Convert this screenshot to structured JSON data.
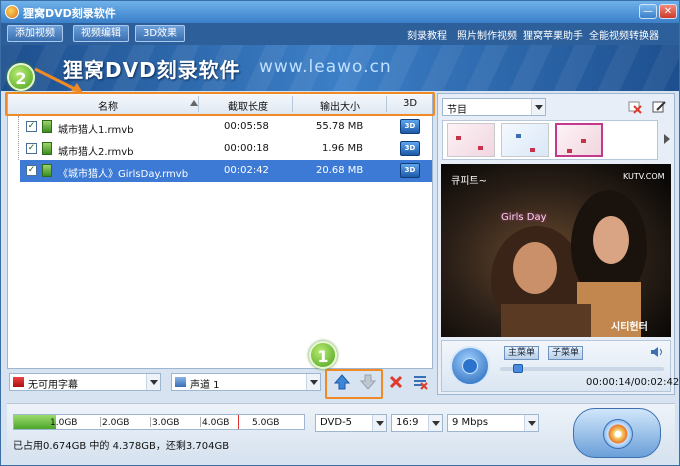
{
  "window": {
    "title": "狸窝DVD刻录软件",
    "min": "—",
    "close": "✕"
  },
  "menubar": {
    "buttons": [
      "添加视频",
      "视频编辑",
      "3D效果"
    ],
    "links": [
      "刻录教程",
      "照片制作视频",
      "狸窝苹果助手",
      "全能视频转换器"
    ]
  },
  "banner": {
    "title": "狸窝DVD刻录软件",
    "url": "www.leawo.cn"
  },
  "table": {
    "columns": [
      "名称",
      "截取长度",
      "输出大小",
      "3D"
    ],
    "rows": [
      {
        "name": "城市猎人1.rmvb",
        "length": "00:05:58",
        "size": "55.78 MB",
        "threeD": "3D",
        "checked": "✓"
      },
      {
        "name": "城市猎人2.rmvb",
        "length": "00:00:18",
        "size": "1.96 MB",
        "threeD": "3D",
        "checked": "✓"
      },
      {
        "name": "《城市猎人》GirlsDay.rmvb",
        "length": "00:02:42",
        "size": "20.68 MB",
        "threeD": "3D",
        "checked": "✓"
      }
    ]
  },
  "subtitle_select": "无可用字幕",
  "audio_select": "声道 1",
  "callouts": {
    "one": "1",
    "two": "2"
  },
  "right": {
    "program_select": "节目",
    "menu_buttons": [
      "主菜单",
      "子菜单"
    ],
    "video_texts": {
      "top_left": "큐피트~",
      "top_right": "KUTV.COM",
      "song": "Girls Day",
      "bottom_right": "시티헌터"
    },
    "time": "00:00:14/00:02:42",
    "playback_fraction": 0.086
  },
  "bottom": {
    "capacity_ticks": [
      "1.0GB",
      "2.0GB",
      "3.0GB",
      "4.0GB",
      "5.0GB"
    ],
    "used_fraction": 0.145,
    "info": "已占用0.674GB 中的 4.378GB，还剩3.704GB",
    "disc_select": "DVD-5",
    "aspect_select": "16:9",
    "bitrate_select": "9 Mbps"
  },
  "colors": {
    "accent": "#f08a24",
    "selection": "#3d7ad6",
    "capacity_fill": "#4ca62c"
  }
}
